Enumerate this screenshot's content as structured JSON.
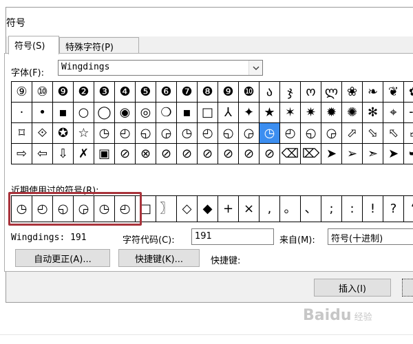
{
  "dialog": {
    "title": "符号"
  },
  "tabs": [
    {
      "label": "符号(S)"
    },
    {
      "label": "特殊字符(P)"
    }
  ],
  "font": {
    "label": "字体(F):",
    "value": "Wingdings"
  },
  "grid": {
    "rows": [
      [
        "⑨",
        "⑩",
        "❾",
        "❷",
        "❸",
        "❹",
        "❺",
        "❻",
        "❼",
        "❽",
        "❾",
        "❿",
        "ა",
        "ჯ",
        "ო",
        "ლ",
        "❀",
        "❧",
        "❦",
        "✿"
      ],
      [
        "·",
        "•",
        "▪",
        "○",
        "◯",
        "◉",
        "◎",
        "❍",
        "▪",
        "□",
        "⅄",
        "✦",
        "★",
        "✶",
        "✷",
        "✹",
        "✺",
        "✻",
        "⌖",
        "⊹"
      ],
      [
        "⌑",
        "⟐",
        "✪",
        "☆",
        "◷",
        "◴",
        "◵",
        "◶",
        "◷",
        "◴",
        "◵",
        "◶",
        "◷",
        "◴",
        "◵",
        "◶",
        "⬀",
        "⬂",
        "⬁",
        "⬃"
      ],
      [
        "⇨",
        "⇦",
        "⇩",
        "✗",
        "▣",
        "⊘",
        "⊗",
        "⊘",
        "⊘",
        "⊘",
        "⊘",
        "⊘",
        "⊘",
        "⌫",
        "⌦",
        "➤",
        "➢",
        "➣",
        "➤",
        "➥"
      ]
    ],
    "selected_row": 2,
    "selected_col": 12
  },
  "recent": {
    "label": "近期使用过的符号(R):",
    "symbols": [
      "◷",
      "◴",
      "◵",
      "◶",
      "◷",
      "◴",
      "□",
      "〗",
      "◇",
      "◆",
      "+",
      "×",
      ",",
      "。",
      "、",
      ";",
      ":",
      "!",
      "?",
      "“"
    ]
  },
  "info": {
    "font_code": "Wingdings: 191",
    "charcode_label": "字符代码(C):",
    "charcode_value": "191",
    "from_label": "来自(M):",
    "from_value": "符号(十进制)"
  },
  "buttons": {
    "autocorrect": "自动更正(A)...",
    "shortcut_key": "快捷键(K)...",
    "shortcut_label": "快捷键:",
    "insert": "插入(I)"
  },
  "watermark": {
    "text": "Baidu",
    "sub": "经验"
  }
}
